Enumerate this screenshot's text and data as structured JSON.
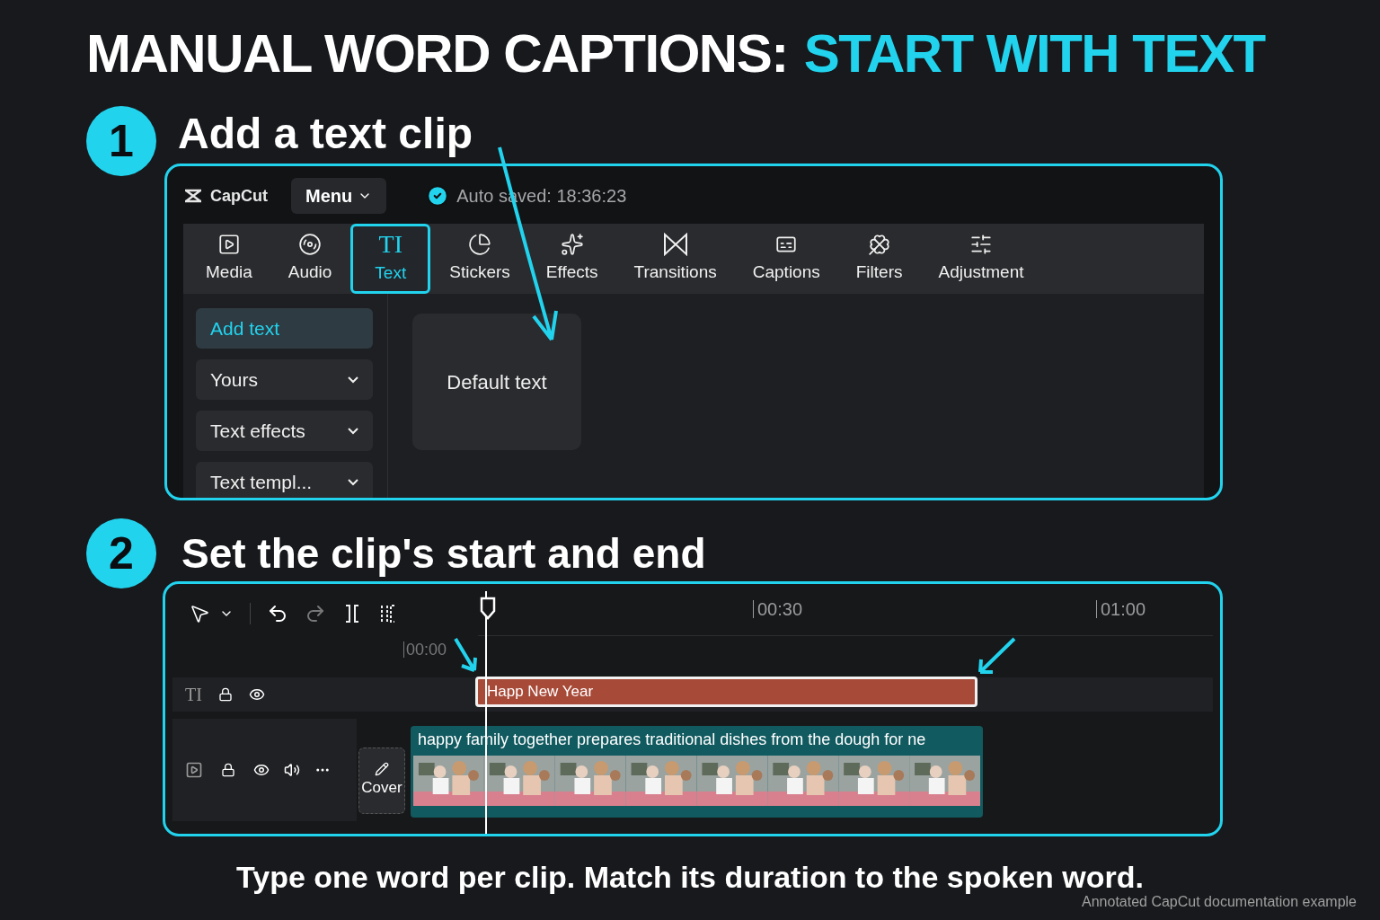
{
  "title": {
    "lead": "MANUAL WORD CAPTIONS:",
    "highlight": "START WITH TEXT"
  },
  "steps": [
    {
      "number": "1",
      "heading": "Add a text clip"
    },
    {
      "number": "2",
      "heading": "Set the clip's start and end"
    }
  ],
  "editor": {
    "logo": "CapCut",
    "menu": "Menu",
    "autosave": "Auto saved: 18:36:23",
    "tabs": [
      {
        "label": "Media",
        "selected": false
      },
      {
        "label": "Audio",
        "selected": false
      },
      {
        "label": "Text",
        "glyph": "TI",
        "selected": true
      },
      {
        "label": "Stickers",
        "selected": false
      },
      {
        "label": "Effects",
        "selected": false
      },
      {
        "label": "Transitions",
        "selected": false
      },
      {
        "label": "Captions",
        "selected": false
      },
      {
        "label": "Filters",
        "selected": false
      },
      {
        "label": "Adjustment",
        "selected": false
      }
    ],
    "side_items": [
      {
        "label": "Add text",
        "kind": "button",
        "selected": true
      },
      {
        "label": "Yours",
        "kind": "dropdown",
        "selected": false
      },
      {
        "label": "Text effects",
        "kind": "dropdown",
        "selected": false
      },
      {
        "label": "Text templ...",
        "kind": "dropdown",
        "selected": false
      }
    ],
    "card": "Default text"
  },
  "timeline": {
    "ticks": [
      "00:30",
      "01:00"
    ],
    "start_label": "00:00",
    "text_track_glyph": "TI",
    "text_clip": "Happ New Year",
    "video_clip": "happy family together prepares traditional dishes from the dough for ne",
    "cover": "Cover"
  },
  "footer": "Type one word per clip. Match its duration to the spoken word.",
  "credit": "Annotated CapCut documentation example"
}
